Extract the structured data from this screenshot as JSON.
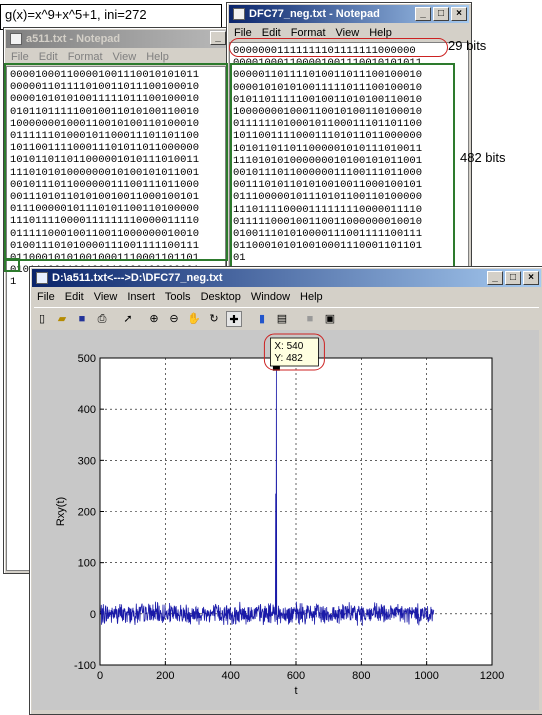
{
  "formula": "g(x)=x^9+x^5+1, ini=272",
  "win_a511": {
    "title": "a511.txt - Notepad",
    "menu": [
      "File",
      "Edit",
      "Format",
      "View",
      "Help"
    ],
    "lines": [
      "000010001100001001110010101011",
      "000001101111010011011100100010",
      "000010101010011111011100100010",
      "010110111110010011010100110010",
      "100000001000110010100110100010",
      "011111101000101100011101101100",
      "101100111100011101011011000000",
      "101011011011000001010111010011",
      "111010101000000010100101011001",
      "001011101100000011100111011000",
      "001110101101010010011000100101",
      "011100000101110101100110100000",
      "111011110000111111110000011110",
      "011111000100110011000000010010",
      "010011101010000111001111100111",
      "011000101010010001110001101101",
      "010111000100100010000100000001",
      "1"
    ]
  },
  "win_dfc": {
    "title": "DFC77_neg.txt - Notepad",
    "menu": [
      "File",
      "Edit",
      "Format",
      "View",
      "Help"
    ],
    "lines": [
      "00000001111111101111111000000",
      "000010001100001001110010101011",
      "000001101111010011011100100010",
      "000010101010011111011100100010",
      "010110111110010011010100110010",
      "100000001000110010100110100010",
      "011111101000101100011101101100",
      "101100111100011101011011000000",
      "101011011011000001010111010011",
      "111010101000000010100101011001",
      "001011101100000011100111011000",
      "001110101101010010011000100101",
      "011100000101110101100110100000",
      "111011110000111111110000011110",
      "011111000100110011000000010010",
      "010011101010000111001111100111",
      "011000101010010001110001101101",
      "01"
    ]
  },
  "annotations": {
    "bits29": "29 bits",
    "bits482": "482 bits"
  },
  "fig": {
    "title": "D:\\a511.txt<--->D:\\DFC77_neg.txt",
    "menu": [
      "File",
      "Edit",
      "View",
      "Insert",
      "Tools",
      "Desktop",
      "Window",
      "Help"
    ],
    "datatip": {
      "x_label": "X: 540",
      "y_label": "Y: 482"
    },
    "xlabel": "t",
    "ylabel": "Rxy(t)"
  },
  "chart_data": {
    "type": "line",
    "title": "",
    "xlabel": "t",
    "ylabel": "Rxy(t)",
    "xlim": [
      0,
      1200
    ],
    "ylim": [
      -100,
      500
    ],
    "xticks": [
      0,
      200,
      400,
      600,
      800,
      1000,
      1200
    ],
    "yticks": [
      -100,
      0,
      100,
      200,
      300,
      400,
      500
    ],
    "grid": true,
    "series": [
      {
        "x_range": [
          1,
          1022
        ],
        "noise_amplitude": 25,
        "peaks": [
          {
            "x": 540,
            "y": 482
          },
          {
            "x": 538,
            "y": 235
          }
        ]
      }
    ],
    "datatip": {
      "x": 540,
      "y": 482
    }
  }
}
